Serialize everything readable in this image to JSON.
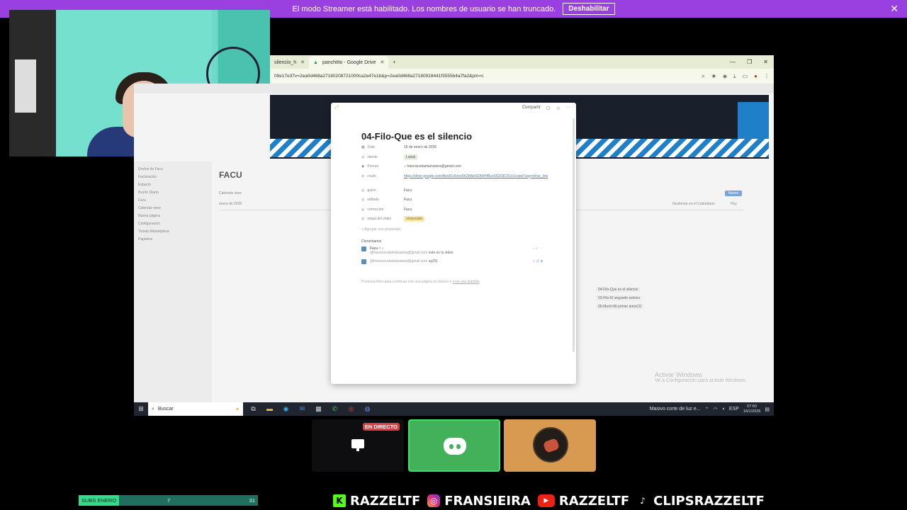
{
  "banner": {
    "text": "El modo Streamer está habilitado. Los nombres de usuario se han truncado.",
    "button_label": "Deshabilitar",
    "close_glyph": "✕"
  },
  "browser": {
    "tabs": [
      {
        "label": "silencio_h",
        "active": false
      },
      {
        "label": "panchitto - Google Drive",
        "active": true
      }
    ],
    "new_tab_glyph": "+",
    "url": "09e17e37v=2ea0d468a27180208721000ca2e47e1b&p=2ea0d468a27180918441f3555b4a7fa2&pm=c",
    "window_controls": [
      "—",
      "❐",
      "✕"
    ]
  },
  "modal": {
    "topbar": {
      "share_label": "Compartir",
      "menu_glyph": "···"
    },
    "title": "04-Filo-Que es el silencio",
    "properties": [
      {
        "key": "Date",
        "icon": "calendar-icon",
        "value": "16 de enero de 2026",
        "type": "text"
      },
      {
        "key": "cliente",
        "icon": "select-icon",
        "value": "Luisal",
        "type": "tag"
      },
      {
        "key": "Person",
        "icon": "people-icon",
        "value": "franciscodamiansieira@gmail.com",
        "type": "person"
      },
      {
        "key": "crudo",
        "icon": "link-icon",
        "value": "https://drive.google.com/file/d/1d1mo5hOhBe5DAWHBuc5R2OtCOLh1/view?usp=drive_link",
        "type": "link"
      },
      {
        "key": "guion",
        "icon": "select-icon",
        "value": "Facu",
        "type": "text"
      },
      {
        "key": "editado",
        "icon": "select-icon",
        "value": "Facu",
        "type": "text"
      },
      {
        "key": "correccion",
        "icon": "select-icon",
        "value": "Facu",
        "type": "text"
      },
      {
        "key": "etapa del video",
        "icon": "select-icon",
        "value": "empezado",
        "type": "tag-yellow"
      }
    ],
    "add_property_label": "+ Agregar una propiedad",
    "comments_header": "Comentarios",
    "comments": [
      {
        "author": "Facu",
        "time": "4 s",
        "mention": "@franciscodamiansieira@gmail.com",
        "text": "este es tu video"
      },
      {
        "author": "",
        "time": "",
        "mention": "@franciscodamiansieira@gmail.com",
        "text": "sg20"
      }
    ],
    "footer_text": "Presiona Intro para continuar con una página en blanco o",
    "footer_link": "crea una plantilla"
  },
  "background_page": {
    "title": "FACU",
    "view_label": "Calendar view",
    "month_label": "enero de 2026",
    "manage_label": "Gestionar en el Calendario",
    "today_label": "Hoy",
    "new_button_label": "Nuevo",
    "events": [
      "04-Filo-Que es el silencio",
      "03-Filo-El segundo estoico",
      "05-Murió-Mi primer amor(11"
    ],
    "sidebar_items": [
      "Envíos de Facu",
      "Facturación",
      "Espacio",
      "Buzón Diario",
      "Facu",
      "Calendar view",
      "Nueva página",
      "Configuración",
      "Tienda Marketplace",
      "Papelera"
    ],
    "activate_windows_title": "Activar Windows",
    "activate_windows_sub": "Ve a Configuración para activar Windows."
  },
  "taskbar": {
    "search_placeholder": "Buscar",
    "notification_text": "Masivo corte de luz e...",
    "language": "ESP",
    "time": "07:50",
    "date": "16/1/2026"
  },
  "call": {
    "live_badge": "EN DIRECTO"
  },
  "subs_goal": {
    "label": "SUBS ENERO",
    "current": "7",
    "goal": "31",
    "progress_fraction": 0.226
  },
  "socials": [
    {
      "icon": "kick-icon",
      "glyph": "K",
      "handle": "RAZZELTF"
    },
    {
      "icon": "instagram-icon",
      "glyph": "◎",
      "handle": "FRANSIEIRA"
    },
    {
      "icon": "youtube-icon",
      "glyph": "▶",
      "handle": "RAZZELTF"
    },
    {
      "icon": "tiktok-icon",
      "glyph": "♪",
      "handle": "CLIPSRAZZELTF"
    }
  ],
  "colors": {
    "banner": "#9b40e0",
    "discord_speaking": "#43b15a",
    "live_red": "#e23b3b",
    "subs_fill": "#2fdd8a"
  }
}
